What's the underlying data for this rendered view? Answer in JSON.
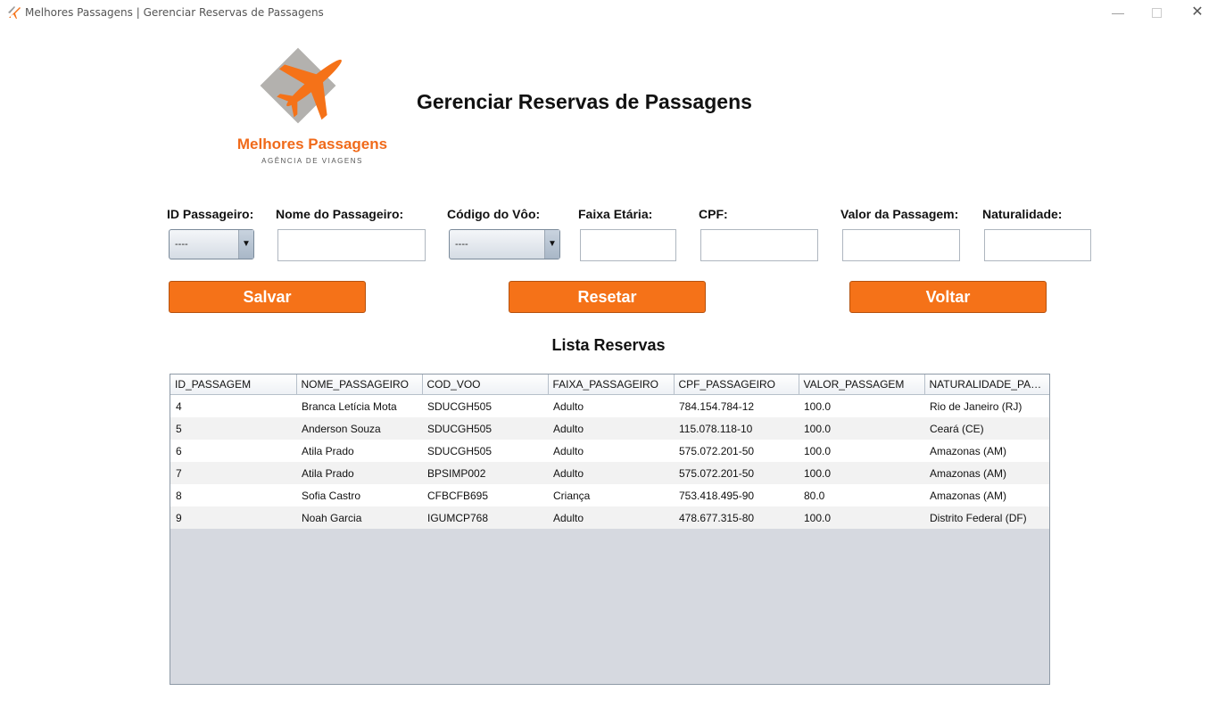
{
  "window": {
    "title": "Melhores Passagens | Gerenciar Reservas de Passagens"
  },
  "logo": {
    "name": "Melhores Passagens",
    "subtitle": "AGÊNCIA DE VIAGENS"
  },
  "page_title": "Gerenciar Reservas de Passagens",
  "form": {
    "id_label": "ID Passageiro:",
    "id_value": "----",
    "name_label": "Nome do Passageiro:",
    "name_value": "",
    "flight_label": "Código do Vôo:",
    "flight_value": "----",
    "age_label": "Faixa Etária:",
    "age_value": "",
    "cpf_label": "CPF:",
    "cpf_value": "",
    "price_label": "Valor da Passagem:",
    "price_value": "",
    "origin_label": "Naturalidade:",
    "origin_value": ""
  },
  "buttons": {
    "save": "Salvar",
    "reset": "Resetar",
    "back": "Voltar"
  },
  "list_title": "Lista Reservas",
  "table": {
    "columns": [
      "ID_PASSAGEM",
      "NOME_PASSAGEIRO",
      "COD_VOO",
      "FAIXA_PASSAGEIRO",
      "CPF_PASSAGEIRO",
      "VALOR_PASSAGEM",
      "NATURALIDADE_PAS..."
    ],
    "rows": [
      [
        "4",
        "Branca Letícia Mota",
        "SDUCGH505",
        "Adulto",
        "784.154.784-12",
        "100.0",
        "Rio de Janeiro (RJ)"
      ],
      [
        "5",
        "Anderson Souza",
        "SDUCGH505",
        "Adulto",
        "115.078.118-10",
        "100.0",
        "Ceará (CE)"
      ],
      [
        "6",
        "Atila Prado",
        "SDUCGH505",
        "Adulto",
        "575.072.201-50",
        "100.0",
        "Amazonas (AM)"
      ],
      [
        "7",
        "Atila Prado",
        "BPSIMP002",
        "Adulto",
        "575.072.201-50",
        "100.0",
        "Amazonas (AM)"
      ],
      [
        "8",
        "Sofia Castro",
        "CFBCFB695",
        "Criança",
        "753.418.495-90",
        "80.0",
        "Amazonas (AM)"
      ],
      [
        "9",
        "Noah Garcia",
        "IGUMCP768",
        "Adulto",
        "478.677.315-80",
        "100.0",
        "Distrito Federal (DF)"
      ]
    ]
  },
  "colors": {
    "accent": "#f57218",
    "logo_gray": "#b3b1ae"
  }
}
